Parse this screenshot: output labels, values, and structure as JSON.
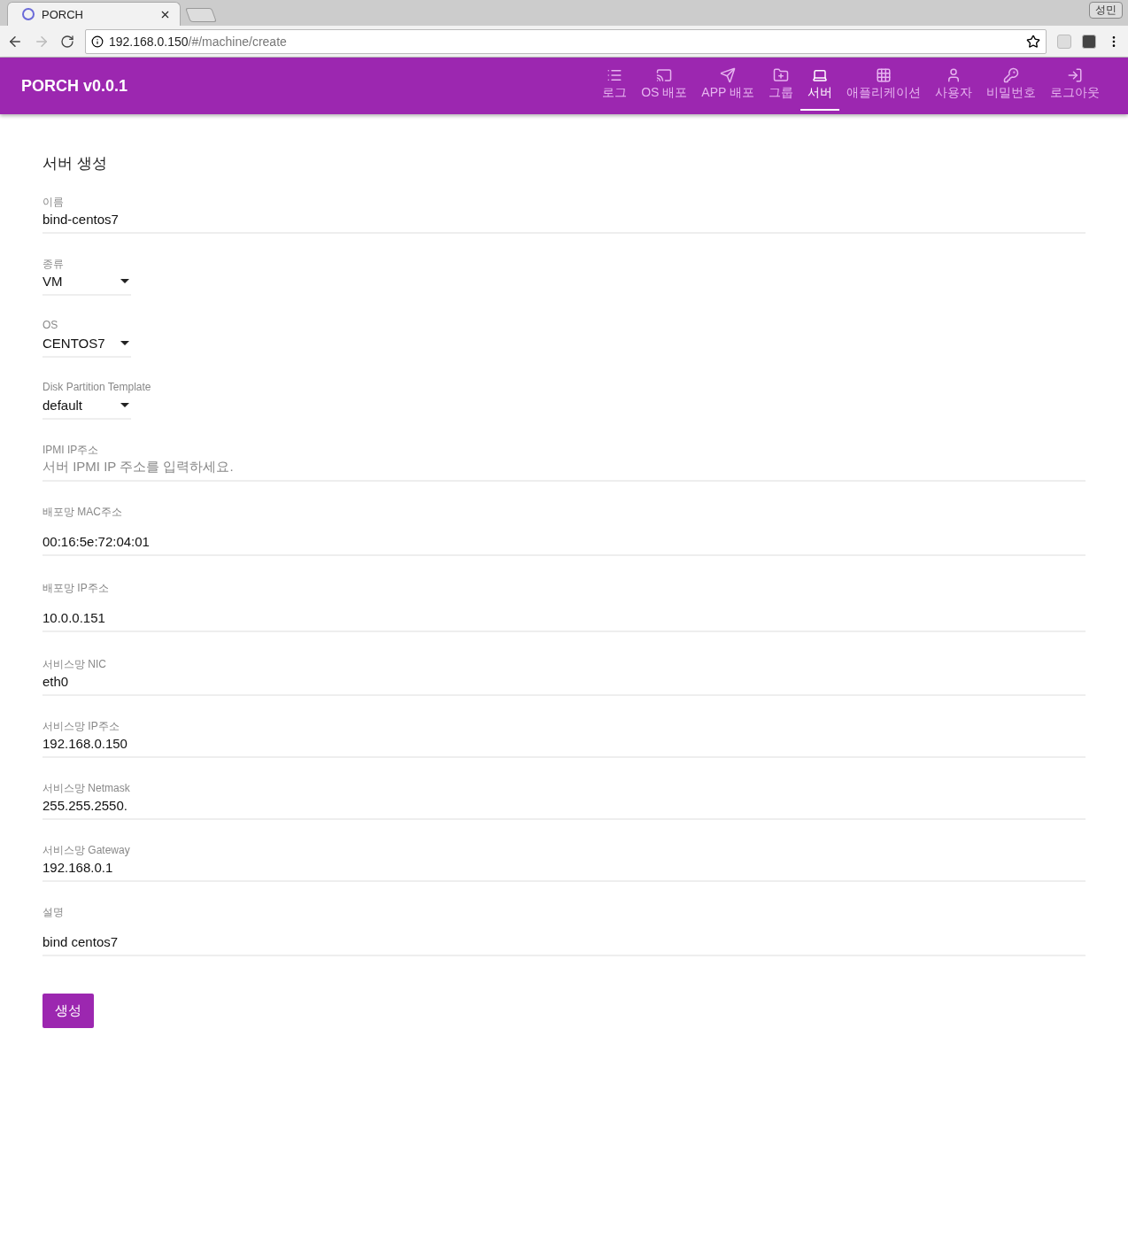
{
  "browser": {
    "tab_title": "PORCH",
    "profile": "성민",
    "url_host": "192.168.0.150",
    "url_path": "/#/machine/create"
  },
  "app": {
    "title": "PORCH v0.0.1"
  },
  "nav": [
    {
      "label": "로그",
      "selected": false
    },
    {
      "label": "OS 배포",
      "selected": false
    },
    {
      "label": "APP 배포",
      "selected": false
    },
    {
      "label": "그룹",
      "selected": false
    },
    {
      "label": "서버",
      "selected": true
    },
    {
      "label": "애플리케이션",
      "selected": false
    },
    {
      "label": "사용자",
      "selected": false
    },
    {
      "label": "비밀번호",
      "selected": false
    },
    {
      "label": "로그아웃",
      "selected": false
    }
  ],
  "form": {
    "title": "서버 생성",
    "fields": [
      {
        "kind": "text",
        "label": "이름",
        "value": "bind-centos7"
      },
      {
        "kind": "select",
        "label": "종류",
        "value": "VM"
      },
      {
        "kind": "select",
        "label": "OS",
        "value": "CENTOS7"
      },
      {
        "kind": "select",
        "label": "Disk Partition Template",
        "value": "default"
      },
      {
        "kind": "text",
        "label": "IPMI IP주소",
        "placeholder": "서버 IPMI IP 주소를 입력하세요."
      },
      {
        "kind": "tall",
        "label": "배포망 MAC주소",
        "value": "00:16:5e:72:04:01"
      },
      {
        "kind": "tall",
        "label": "배포망 IP주소",
        "value": "10.0.0.151"
      },
      {
        "kind": "text",
        "label": "서비스망 NIC",
        "value": "eth0"
      },
      {
        "kind": "text",
        "label": "서비스망 IP주소",
        "value": "192.168.0.150"
      },
      {
        "kind": "text",
        "label": "서비스망 Netmask",
        "value": "255.255.2550."
      },
      {
        "kind": "text",
        "label": "서비스망 Gateway",
        "value": "192.168.0.1"
      },
      {
        "kind": "tall",
        "label": "설명",
        "value": "bind centos7"
      }
    ],
    "submit": "생성"
  }
}
